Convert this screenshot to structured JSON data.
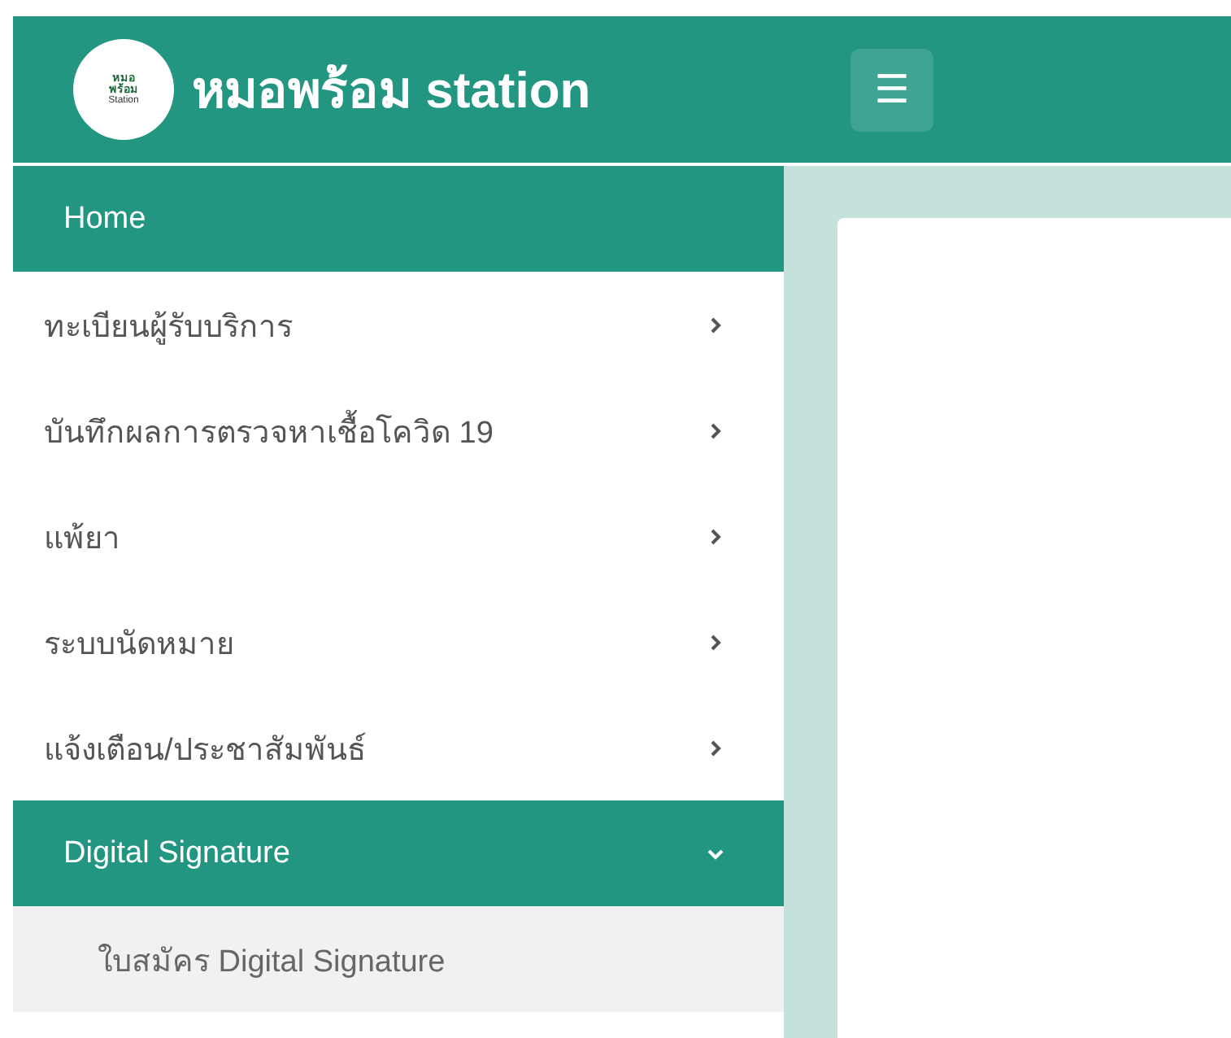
{
  "header": {
    "logo_text": [
      "หมอ",
      "พร้อม",
      "Station"
    ],
    "title": "หมอพร้อม station",
    "menu_button": "☰"
  },
  "sidebar": {
    "items": [
      {
        "label": "Home",
        "selected": true
      },
      {
        "label": "ทะเบียนผู้รับบริการ",
        "selected": false,
        "expanded": false
      },
      {
        "label": "บันทึกผลการตรวจหาเชื้อโควิด 19",
        "selected": false,
        "expanded": false
      },
      {
        "label": "แพ้ยา",
        "selected": false,
        "expanded": false
      },
      {
        "label": "ระบบนัดหมาย",
        "selected": false,
        "expanded": false
      },
      {
        "label": "แจ้งเตือน/ประชาสัมพันธ์",
        "selected": false,
        "expanded": false
      },
      {
        "label": "Digital Signature",
        "expanded": true,
        "children": [
          {
            "label": "ใบสมัคร Digital Signature"
          }
        ]
      }
    ]
  }
}
